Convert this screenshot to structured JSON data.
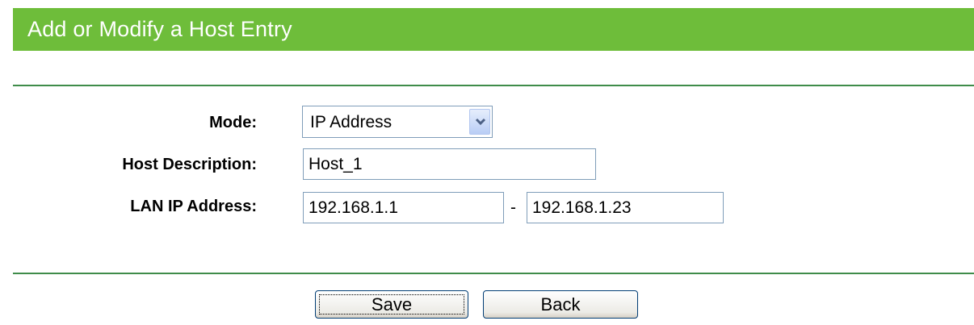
{
  "header": {
    "title": "Add or Modify a Host Entry"
  },
  "form": {
    "mode": {
      "label": "Mode:",
      "value": "IP Address"
    },
    "host_description": {
      "label": "Host Description:",
      "value": "Host_1"
    },
    "lan_ip": {
      "label": "LAN IP Address:",
      "start": "192.168.1.1",
      "separator": "-",
      "end": "192.168.1.23"
    }
  },
  "buttons": {
    "save": "Save",
    "back": "Back"
  },
  "colors": {
    "header_bg": "#6ebd3a",
    "rule": "#3f8c4a"
  },
  "icons": {
    "select_arrow": "chevron-down-icon"
  }
}
